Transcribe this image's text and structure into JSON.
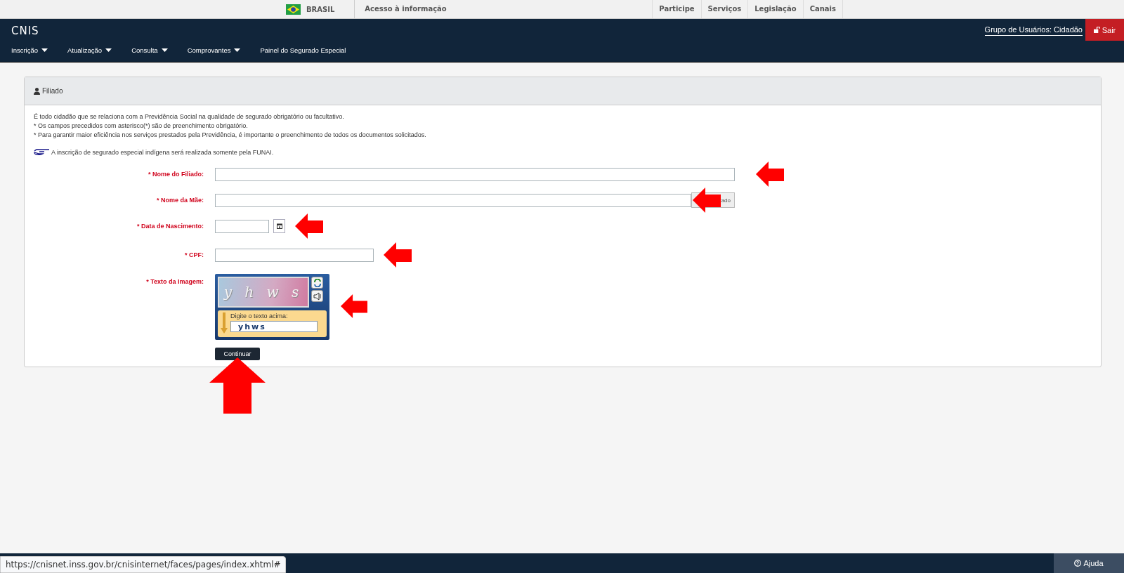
{
  "gov_bar": {
    "country": "BRASIL",
    "access_link": "Acesso à informação",
    "links": [
      "Participe",
      "Serviços",
      "Legislação",
      "Canais"
    ]
  },
  "header": {
    "logo": "CNIS",
    "user_group": "Grupo de Usuários: Cidadão",
    "logout": "Sair"
  },
  "menu": [
    {
      "label": "Inscrição",
      "dropdown": true
    },
    {
      "label": "Atualização",
      "dropdown": true
    },
    {
      "label": "Consulta",
      "dropdown": true
    },
    {
      "label": "Comprovantes",
      "dropdown": true
    },
    {
      "label": "Painel do Segurado Especial",
      "dropdown": false
    }
  ],
  "panel": {
    "title": "Filiado",
    "intro": [
      "É todo cidadão que se relaciona com a Previdência Social na qualidade de segurado obrigatório ou facultativo.",
      "* Os campos precedidos com asterisco(*) são de preenchimento obrigatório.",
      "* Para garantir maior eficiência nos serviços prestados pela Previdência, é importante o preenchimento de todos os documentos solicitados."
    ],
    "notice": "A inscrição de segurado especial indígena será realizada somente pela FUNAI.",
    "fields": [
      {
        "kind": "wide",
        "label": "* Nome do Filiado:"
      },
      {
        "kind": "with_button",
        "label": "* Nome da Mãe:",
        "button": "rado"
      },
      {
        "kind": "date",
        "label": "* Data de Nascimento:"
      },
      {
        "kind": "medium",
        "label": "* CPF:"
      },
      {
        "kind": "captcha",
        "label": "* Texto da Imagem:",
        "captcha_text": "y h w s",
        "prompt": "Digite o texto acima:",
        "value": "yhws"
      }
    ],
    "submit": "Continuar"
  },
  "status_url": "https://cnisnet.inss.gov.br/cnisinternet/faces/pages/index.xhtml#",
  "help": "Ajuda"
}
